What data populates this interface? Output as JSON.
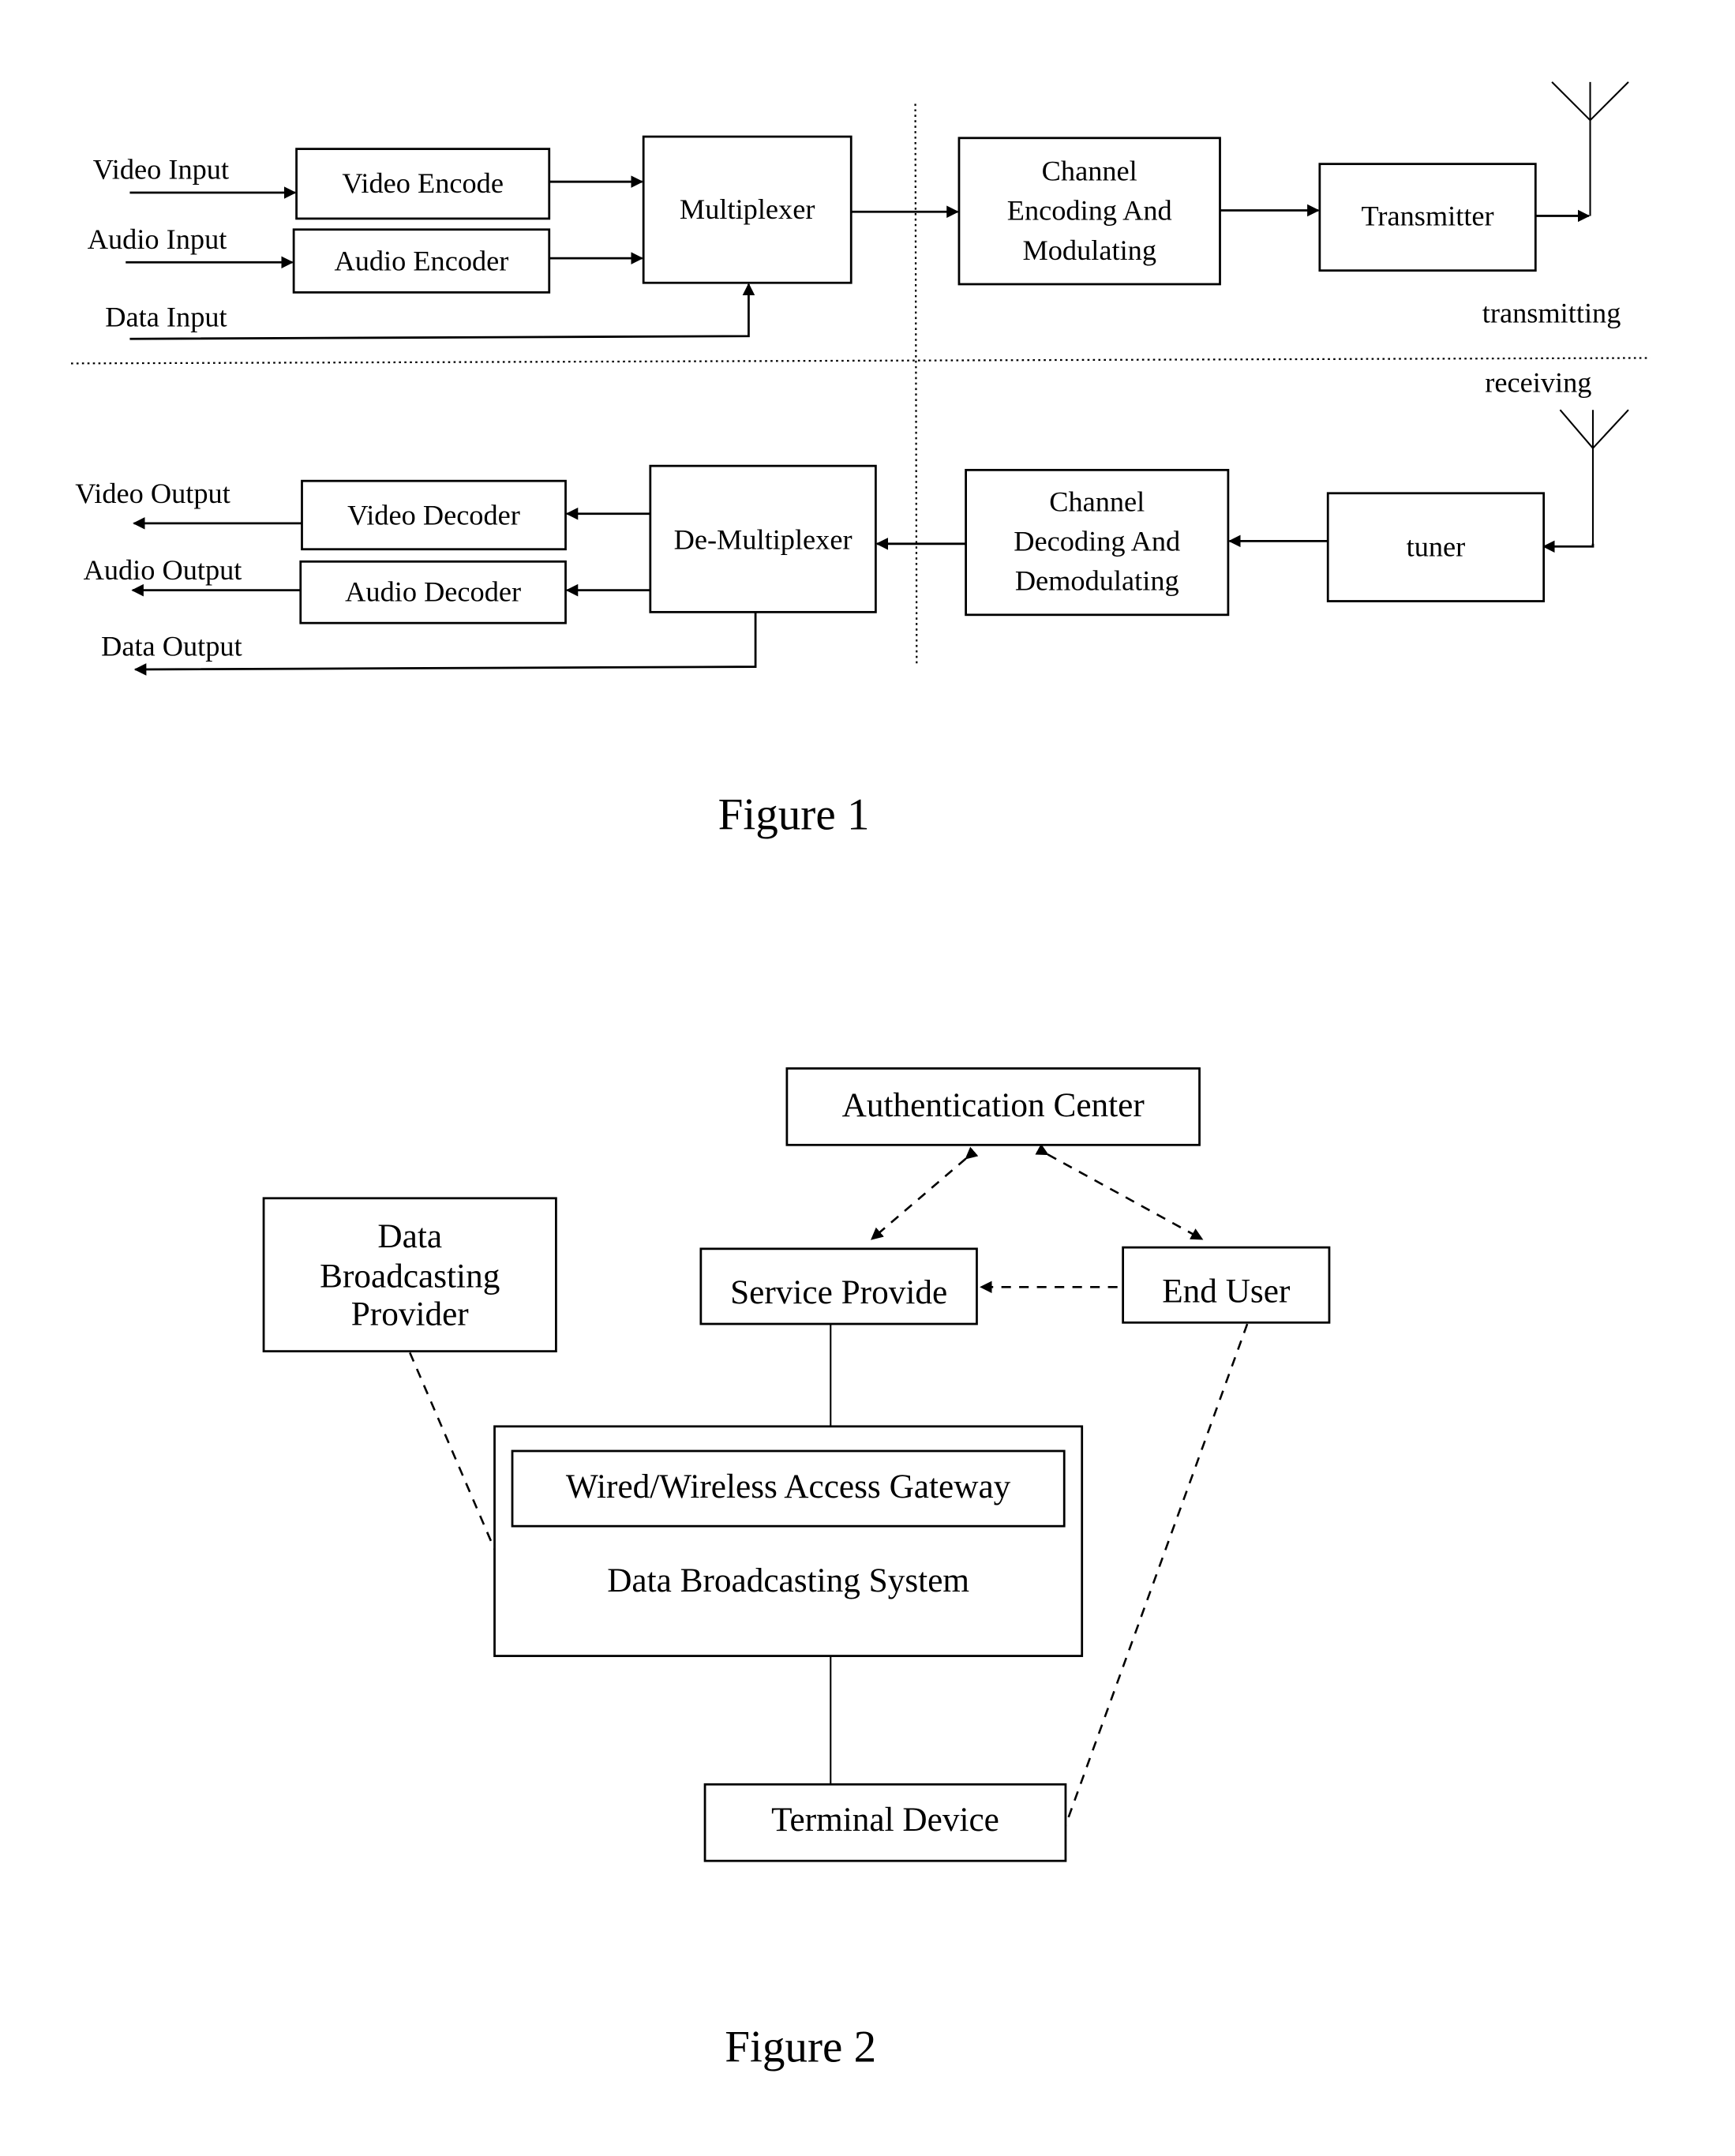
{
  "figure1": {
    "caption": "Figure 1",
    "inputs": {
      "video": "Video Input",
      "audio": "Audio Input",
      "data": "Data Input"
    },
    "outputs": {
      "video": "Video Output",
      "audio": "Audio Output",
      "data": "Data Output"
    },
    "blocks": {
      "video_encode": "Video Encode",
      "audio_encoder": "Audio Encoder",
      "multiplexer": "Multiplexer",
      "channel_encoding": [
        "Channel",
        "Encoding And",
        "Modulating"
      ],
      "transmitter": "Transmitter",
      "video_decoder": "Video Decoder",
      "audio_decoder": "Audio Decoder",
      "demultiplexer": "De-Multiplexer",
      "channel_decoding": [
        "Channel",
        "Decoding And",
        "Demodulating"
      ],
      "tuner": "tuner"
    },
    "side_labels": {
      "transmitting": "transmitting",
      "receiving": "receiving"
    }
  },
  "figure2": {
    "caption": "Figure 2",
    "blocks": {
      "authentication_center": "Authentication Center",
      "data_broadcasting_provider": [
        "Data",
        "Broadcasting",
        "Provider"
      ],
      "service_provide": "Service Provide",
      "end_user": "End User",
      "gateway": "Wired/Wireless Access Gateway",
      "data_broadcasting_system": "Data Broadcasting System",
      "terminal_device": "Terminal Device"
    }
  }
}
